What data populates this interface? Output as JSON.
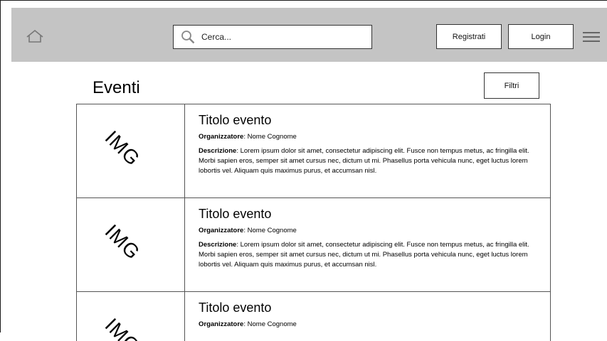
{
  "header": {
    "search_placeholder": "Cerca...",
    "register_label": "Registrati",
    "login_label": "Login",
    "icons": {
      "home": "home-icon",
      "search": "search-icon",
      "menu": "hamburger-menu-icon"
    }
  },
  "page": {
    "title": "Eventi",
    "filter_label": "Filtri"
  },
  "events": [
    {
      "image_label": "IMG",
      "title": "Titolo evento",
      "organizer_label": "Organizzatore",
      "organizer_name": ": Nome Cognome",
      "description_label": "Descrizione",
      "description_text": ": Lorem ipsum dolor sit amet, consectetur adipiscing elit. Fusce non tempus metus, ac fringilla elit. Morbi sapien eros, semper sit amet cursus nec, dictum ut mi. Phasellus porta vehicula nunc, eget luctus lorem lobortis vel. Aliquam quis maximus purus, et accumsan nisl."
    },
    {
      "image_label": "IMG",
      "title": "Titolo evento",
      "organizer_label": "Organizzatore",
      "organizer_name": ": Nome Cognome",
      "description_label": "Descrizione",
      "description_text": ": Lorem ipsum dolor sit amet, consectetur adipiscing elit. Fusce non tempus metus, ac fringilla elit. Morbi sapien eros, semper sit amet cursus nec, dictum ut mi. Phasellus porta vehicula nunc, eget luctus lorem lobortis vel. Aliquam quis maximus purus, et accumsan nisl."
    },
    {
      "image_label": "IMG",
      "title": "Titolo evento",
      "organizer_label": "Organizzatore",
      "organizer_name": ": Nome Cognome",
      "description_label": "",
      "description_text": ""
    }
  ]
}
